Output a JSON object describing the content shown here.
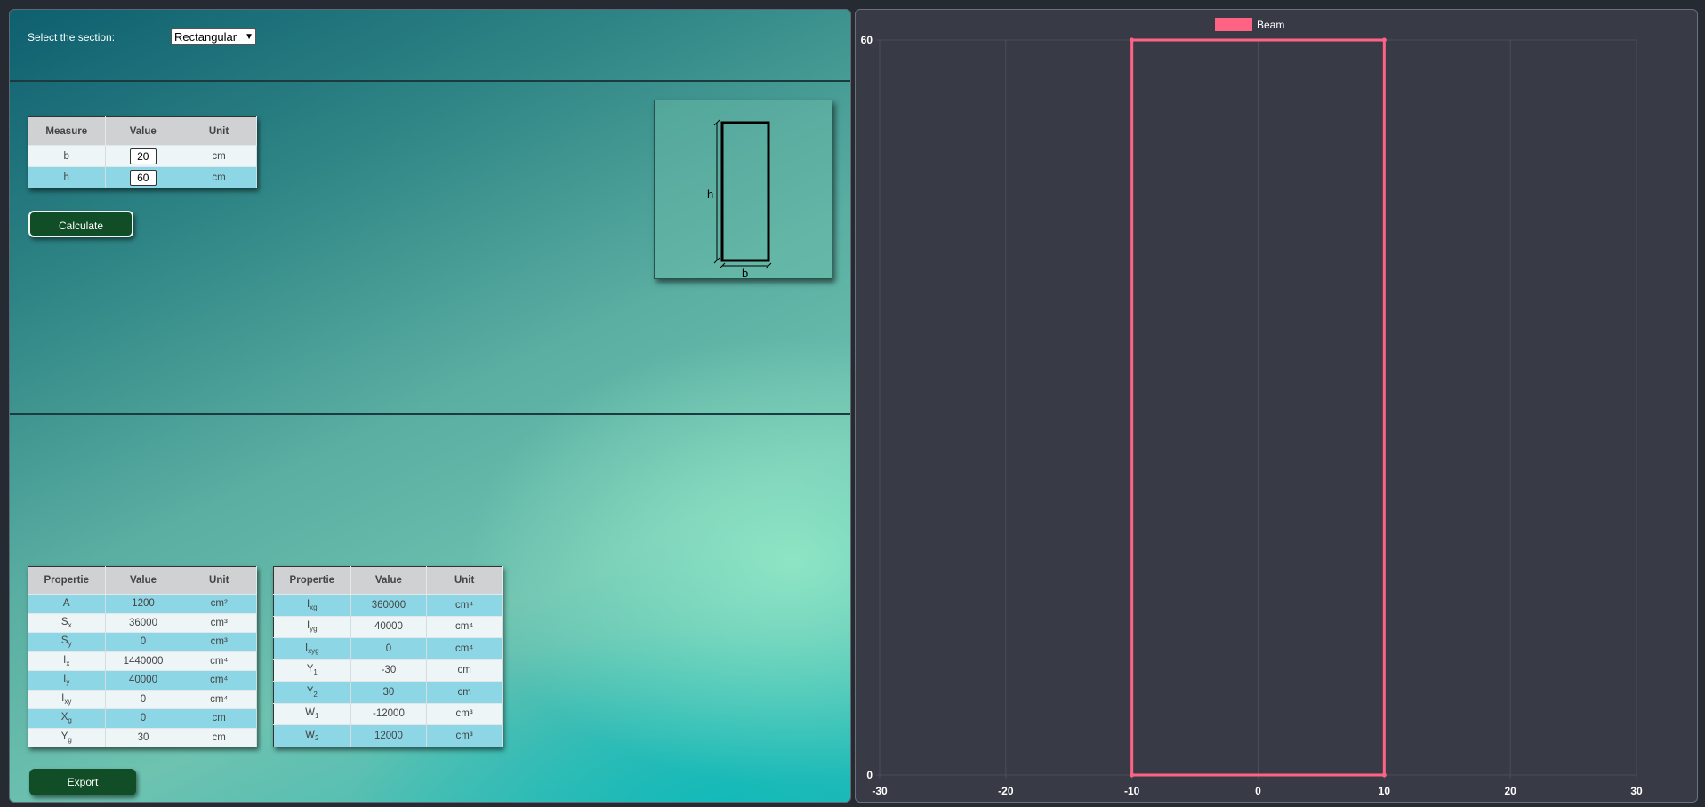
{
  "section_selector": {
    "label": "Select the section:",
    "selected": "Rectangular"
  },
  "input_table": {
    "headers": [
      "Measure",
      "Value",
      "Unit"
    ],
    "rows": [
      {
        "measure": "b",
        "value": "20",
        "unit": "cm"
      },
      {
        "measure": "h",
        "value": "60",
        "unit": "cm"
      }
    ]
  },
  "calculate_label": "Calculate",
  "export_label": "Export",
  "diagram": {
    "h_label": "h",
    "b_label": "b"
  },
  "properties_table_1": {
    "headers": [
      "Propertie",
      "Value",
      "Unit"
    ],
    "rows": [
      {
        "symbol": "A",
        "sub": "",
        "value": "1200",
        "unit": "cm²"
      },
      {
        "symbol": "S",
        "sub": "x",
        "value": "36000",
        "unit": "cm³"
      },
      {
        "symbol": "S",
        "sub": "y",
        "value": "0",
        "unit": "cm³"
      },
      {
        "symbol": "I",
        "sub": "x",
        "value": "1440000",
        "unit": "cm⁴"
      },
      {
        "symbol": "I",
        "sub": "y",
        "value": "40000",
        "unit": "cm⁴"
      },
      {
        "symbol": "I",
        "sub": "xy",
        "value": "0",
        "unit": "cm⁴"
      },
      {
        "symbol": "X",
        "sub": "g",
        "value": "0",
        "unit": "cm"
      },
      {
        "symbol": "Y",
        "sub": "g",
        "value": "30",
        "unit": "cm"
      }
    ]
  },
  "properties_table_2": {
    "headers": [
      "Propertie",
      "Value",
      "Unit"
    ],
    "rows": [
      {
        "symbol": "I",
        "sub": "xg",
        "value": "360000",
        "unit": "cm⁴"
      },
      {
        "symbol": "I",
        "sub": "yg",
        "value": "40000",
        "unit": "cm⁴"
      },
      {
        "symbol": "I",
        "sub": "xyg",
        "value": "0",
        "unit": "cm⁴"
      },
      {
        "symbol": "Y",
        "sub": "1",
        "value": "-30",
        "unit": "cm"
      },
      {
        "symbol": "Y",
        "sub": "2",
        "value": "30",
        "unit": "cm"
      },
      {
        "symbol": "W",
        "sub": "1",
        "value": "-12000",
        "unit": "cm³"
      },
      {
        "symbol": "W",
        "sub": "2",
        "value": "12000",
        "unit": "cm³"
      }
    ]
  },
  "chart_data": {
    "type": "line",
    "legend_position": "top-center",
    "grid": true,
    "series": [
      {
        "name": "Beam",
        "color": "#ff6384",
        "points": [
          [
            -10,
            0
          ],
          [
            -10,
            60
          ],
          [
            10,
            60
          ],
          [
            10,
            0
          ],
          [
            -10,
            0
          ]
        ]
      }
    ],
    "xlim": [
      -30,
      30
    ],
    "ylim": [
      0,
      60
    ],
    "xticks": [
      -30,
      -20,
      -10,
      0,
      10,
      20,
      30
    ],
    "yticks": [
      0,
      60
    ],
    "xlabel": "",
    "ylabel": ""
  },
  "colors": {
    "chart_background": "#383b46",
    "series": "#ff6384",
    "button": "#114d26",
    "row_highlight": "#8dd6e5"
  }
}
